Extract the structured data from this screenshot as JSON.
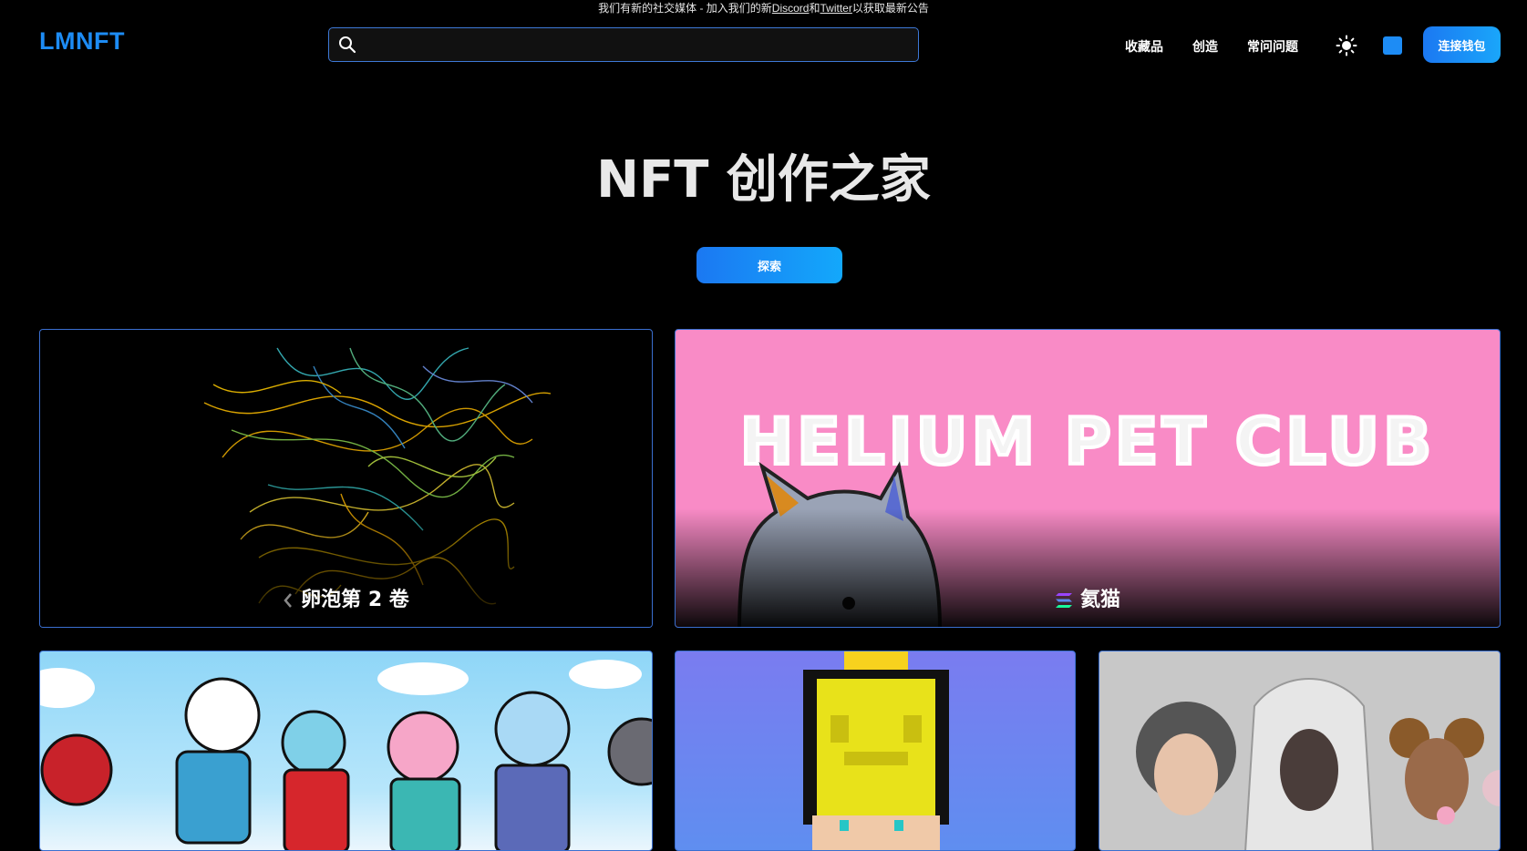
{
  "announcement": {
    "prefix": "我们有新的社交媒体 - 加入我们的新",
    "discord": "Discord",
    "and": "和",
    "twitter": "Twitter",
    "suffix": "以获取最新公告"
  },
  "header": {
    "logo": "LMNFT",
    "search_placeholder": "",
    "nav": [
      "收藏品",
      "创造",
      "常问问题"
    ],
    "connect_wallet": "连接钱包",
    "accent_color": "#1d8cf5"
  },
  "hero": {
    "title": "NFT 创作之家",
    "explore_label": "探索"
  },
  "cards": [
    {
      "caption": "卵泡第 2 卷",
      "chain_icon": "chevron-left-icon"
    },
    {
      "caption": "氦猫",
      "chain_icon": "solana-icon",
      "banner_text": "HELIUM PET CLUB"
    },
    {
      "caption": "",
      "chain_icon": ""
    },
    {
      "caption": "",
      "chain_icon": ""
    },
    {
      "caption": "",
      "chain_icon": ""
    }
  ]
}
